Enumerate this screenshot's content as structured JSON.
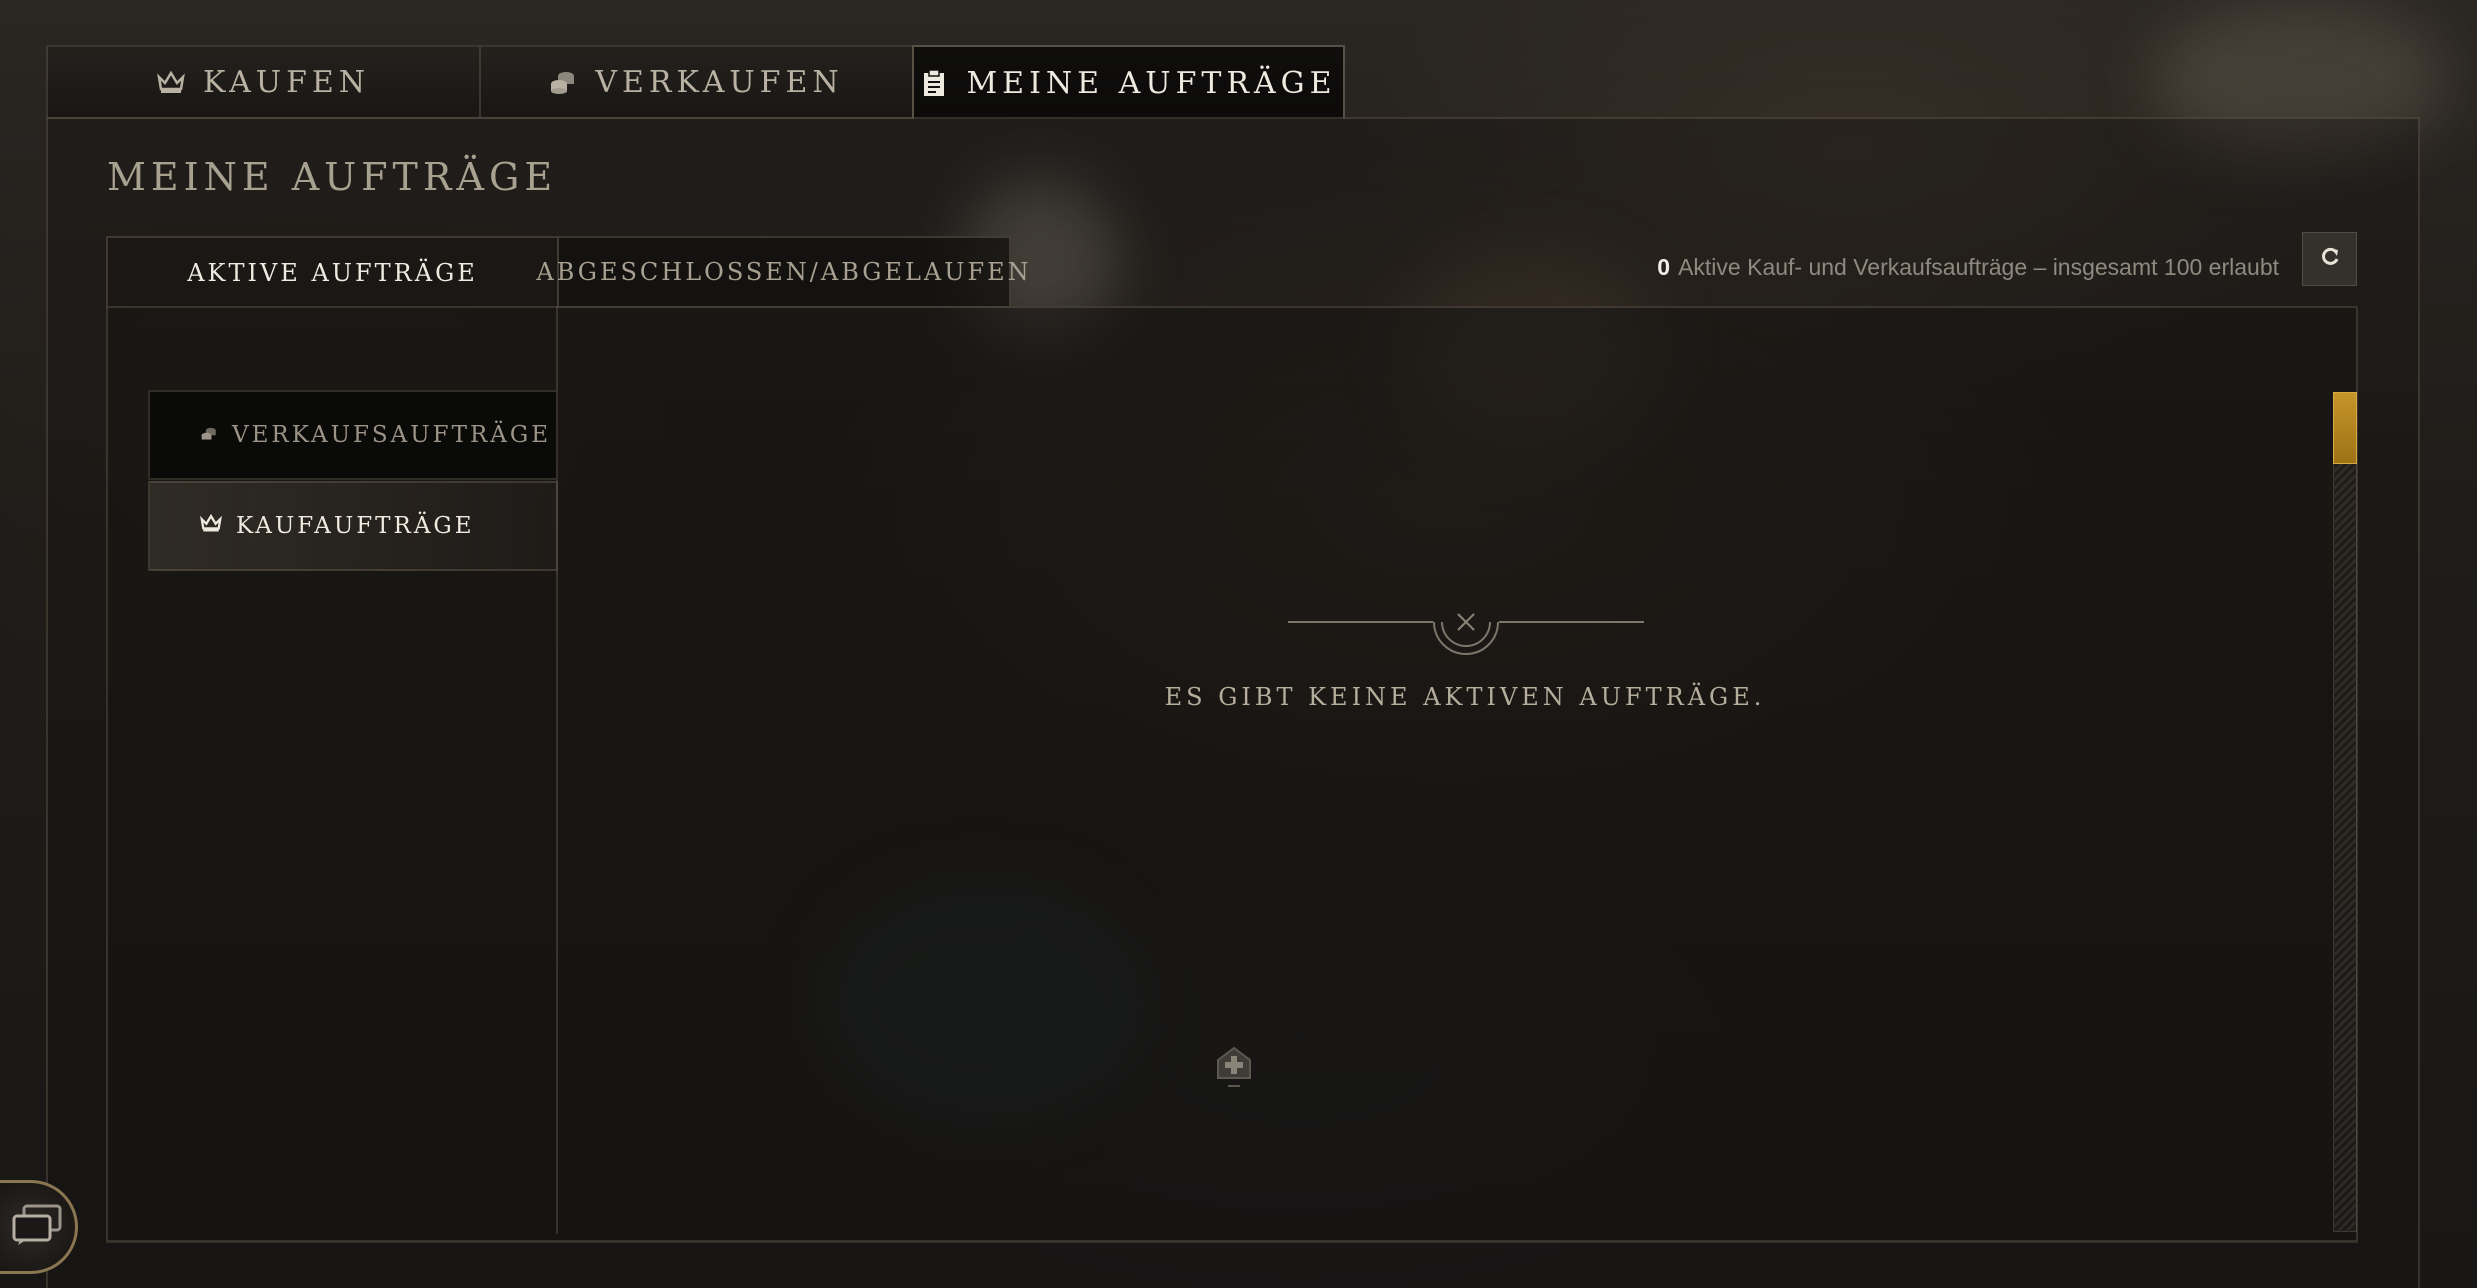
{
  "tabs": [
    {
      "label": "KAUFEN",
      "icon": "crown-icon"
    },
    {
      "label": "VERKAUFEN",
      "icon": "coins-icon"
    },
    {
      "label": "MEINE AUFTRÄGE",
      "icon": "clipboard-icon"
    }
  ],
  "active_tab": "MEINE AUFTRÄGE",
  "page_title": "MEINE AUFTRÄGE",
  "sub_tabs": [
    {
      "label": "AKTIVE AUFTRÄGE"
    },
    {
      "label": "ABGESCHLOSSEN/ABGELAUFEN"
    }
  ],
  "order_count": {
    "count": "0",
    "text": "Aktive Kauf- und Verkaufsaufträge – insgesamt 100 erlaubt"
  },
  "sidebar": {
    "items": [
      {
        "label": "VERKAUFSAUFTRÄGE",
        "icon": "coins-icon"
      },
      {
        "label": "KAUFAUFTRÄGE",
        "icon": "crown-icon"
      }
    ],
    "selected": "KAUFAUFTRÄGE"
  },
  "empty_state": {
    "message": "ES GIBT KEINE AKTIVEN AUFTRÄGE."
  },
  "colors": {
    "accent_gold": "#c6952a",
    "text_light": "#efe9de",
    "text_muted": "#a8a091"
  }
}
